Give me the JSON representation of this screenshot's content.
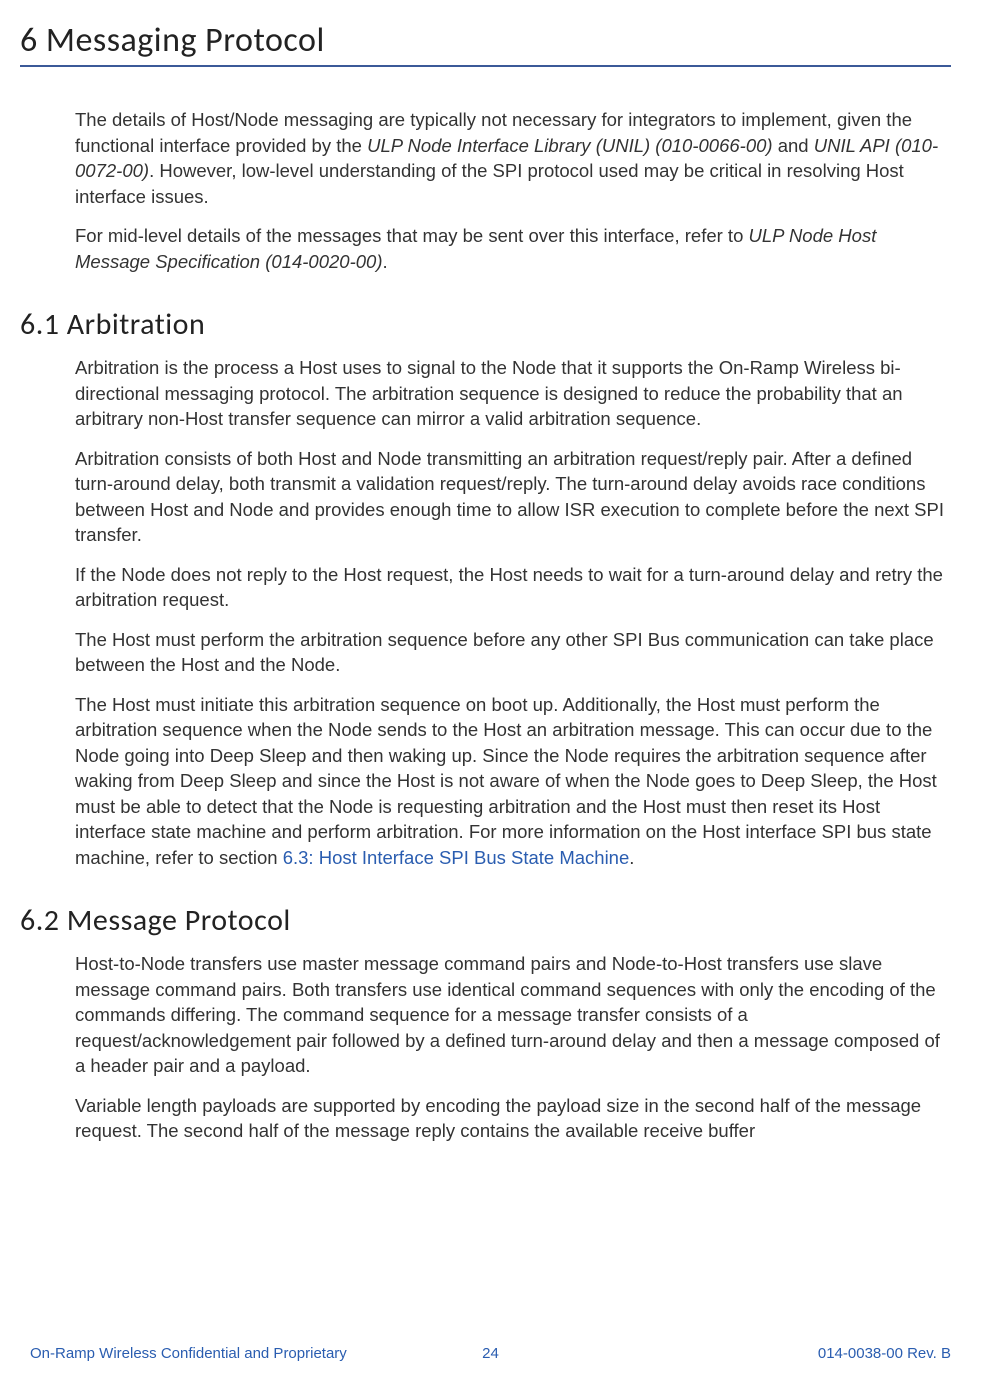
{
  "chapter": {
    "title": "6 Messaging Protocol"
  },
  "intro": {
    "p1_part1": "The details of Host/Node messaging are typically not necessary for integrators to implement, given the functional interface provided by the ",
    "p1_ital1": "ULP Node Interface Library (UNIL) (010-0066-00)",
    "p1_part2": " and ",
    "p1_ital2": "UNIL API (010-0072-00)",
    "p1_part3": ". However, low-level understanding of the SPI protocol used may be critical in resolving Host interface issues.",
    "p2_part1": "For mid-level details of the messages that may be sent over this interface, refer to ",
    "p2_ital1": "ULP Node Host Message Specification (014-0020-00)",
    "p2_part2": "."
  },
  "section_6_1": {
    "title": "6.1 Arbitration",
    "p1": "Arbitration is the process a Host uses to signal to the Node that it supports the On-Ramp Wireless bi-directional messaging protocol. The arbitration sequence is designed to reduce the probability that an arbitrary non-Host transfer sequence can mirror a valid arbitration sequence.",
    "p2": "Arbitration consists of both Host and Node transmitting an arbitration request/reply pair. After a defined turn-around delay, both transmit a validation request/reply. The turn-around delay avoids race conditions between Host and Node and provides enough time to allow ISR execution to complete before the next SPI transfer.",
    "p3": "If the Node does not reply to the Host request, the Host needs to wait for a turn-around delay and retry the arbitration request.",
    "p4": "The Host must perform the arbitration sequence before any other SPI Bus communication can take place between the Host and the Node.",
    "p5_part1": "The Host must initiate this arbitration sequence on boot up. Additionally, the Host must perform the arbitration sequence when the Node sends to the Host an arbitration message. This can occur due to the Node going into Deep Sleep and then waking up. Since the Node requires the arbitration sequence after waking from Deep Sleep and since the Host is not aware of when the Node goes to Deep Sleep, the Host must be able to detect that the Node is requesting arbitration and the Host must then reset its Host interface state machine and perform arbitration. For more information on the Host interface SPI bus state machine, refer to section ",
    "p5_link": "6.3: Host Interface SPI Bus State Machine",
    "p5_part2": "."
  },
  "section_6_2": {
    "title": "6.2 Message Protocol",
    "p1": "Host-to-Node transfers use master message command pairs and Node-to-Host transfers use slave message command pairs. Both transfers use identical command sequences with only the encoding of the commands differing. The command sequence for a message transfer consists of a request/acknowledgement pair followed by a defined turn-around delay and then a message composed of a header pair and a payload.",
    "p2": "Variable length payloads are supported by encoding the payload size in the second half of the message request. The second half of the message reply contains the available receive buffer"
  },
  "footer": {
    "left": "On-Ramp Wireless Confidential and Proprietary",
    "center": "24",
    "right": "014-0038-00 Rev. B"
  }
}
